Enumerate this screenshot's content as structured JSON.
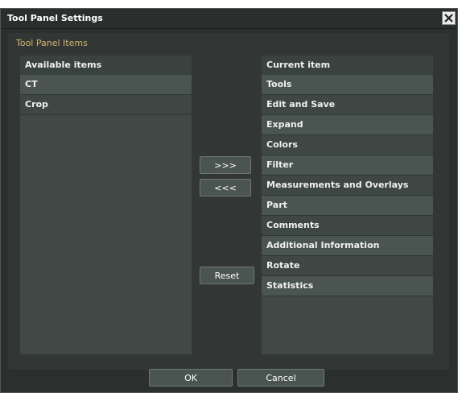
{
  "window": {
    "title": "Tool Panel Settings"
  },
  "group": {
    "title": "Tool Panel Items"
  },
  "available": {
    "header": "Available items",
    "items": [
      "CT",
      "Crop"
    ]
  },
  "current": {
    "header": "Current item",
    "items": [
      "Tools",
      "Edit and Save",
      "Expand",
      "Colors",
      "Filter",
      "Measurements and Overlays",
      "Part",
      "Comments",
      "Additional Information",
      "Rotate",
      "Statistics"
    ]
  },
  "buttons": {
    "add": ">>>",
    "remove": "<<<",
    "reset": "Reset",
    "ok": "OK",
    "cancel": "Cancel"
  },
  "icons": {
    "close": "close-icon"
  },
  "colors": {
    "background": "#2b2f2d",
    "group_title": "#d7b36c",
    "row_alt": "#4a5451",
    "row_plain": "#3e4744"
  }
}
